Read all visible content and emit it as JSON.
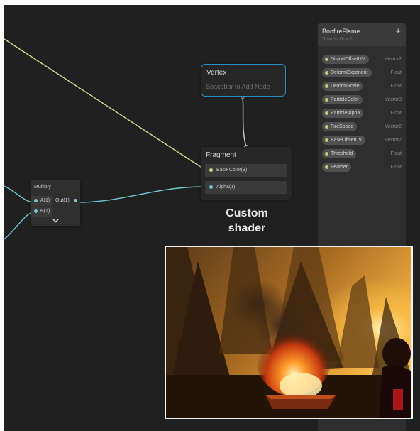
{
  "colors": {
    "canvas_bg": "#202020",
    "vector_wire": "#d4d98a",
    "float_wire": "#6fcad6",
    "vertex_border": "#2a8ec9",
    "property_dot": "#b7d46b"
  },
  "vertex_node": {
    "title": "Vertex",
    "placeholder": "Spacebar to Add Node"
  },
  "fragment_node": {
    "title": "Fragment",
    "ports": [
      {
        "label": "Base Color(3)"
      },
      {
        "label": "Alpha(1)"
      }
    ]
  },
  "multiply_node": {
    "title": "Multiply",
    "inputs": [
      {
        "label": "A(1)"
      },
      {
        "label": "B(1)"
      }
    ],
    "output": {
      "label": "Out(1)"
    },
    "collapse_icon": "chevron-down-icon"
  },
  "overlay": {
    "line1": "Custom",
    "line2": "shader"
  },
  "blackboard": {
    "title": "BonfireFlame",
    "subtitle": "Shader Graph",
    "add_label": "+",
    "properties": [
      {
        "name": "DistortOffsetUV",
        "type": "Vector2"
      },
      {
        "name": "DeformExponent",
        "type": "Float"
      },
      {
        "name": "DeformScale",
        "type": "Float"
      },
      {
        "name": "ParticleColor",
        "type": "Vector3"
      },
      {
        "name": "ParticleAlpha",
        "type": "Float"
      },
      {
        "name": "FireSpeed",
        "type": "Vector2"
      },
      {
        "name": "BaseOffsetUV",
        "type": "Vector2"
      },
      {
        "name": "Threshold",
        "type": "Float"
      },
      {
        "name": "Feather",
        "type": "Float"
      }
    ]
  },
  "preview": {
    "scene": "low-poly forest bonfire at sunset"
  }
}
